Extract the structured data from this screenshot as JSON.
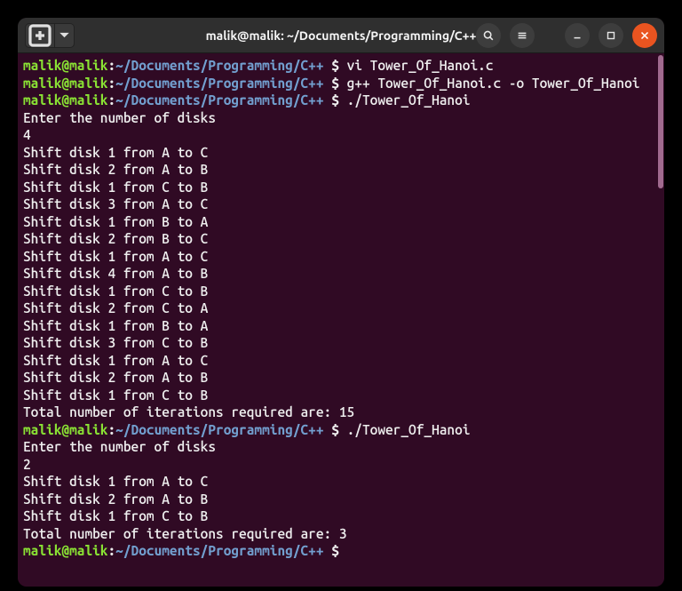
{
  "titlebar": {
    "title": "malik@malik: ~/Documents/Programming/C++",
    "newtab_icon": "new-tab-icon",
    "dropdown_icon": "chevron-down-icon",
    "search_icon": "search-icon",
    "menu_icon": "hamburger-icon",
    "min_icon": "minimize-icon",
    "max_icon": "maximize-icon",
    "close_icon": "close-icon"
  },
  "prompt": {
    "userhost": "malik@malik",
    "colon": ":",
    "path": "~/Documents/Programming/C++",
    "dollar": " $ "
  },
  "session": {
    "entries": [
      {
        "type": "prompt",
        "cmd": "vi Tower_Of_Hanoi.c"
      },
      {
        "type": "prompt",
        "cmd": "g++ Tower_Of_Hanoi.c -o Tower_Of_Hanoi"
      },
      {
        "type": "prompt",
        "cmd": "./Tower_Of_Hanoi"
      },
      {
        "type": "out",
        "text": "Enter the number of disks"
      },
      {
        "type": "out",
        "text": "4"
      },
      {
        "type": "out",
        "text": "Shift disk 1 from A to C"
      },
      {
        "type": "out",
        "text": "Shift disk 2 from A to B"
      },
      {
        "type": "out",
        "text": "Shift disk 1 from C to B"
      },
      {
        "type": "out",
        "text": "Shift disk 3 from A to C"
      },
      {
        "type": "out",
        "text": "Shift disk 1 from B to A"
      },
      {
        "type": "out",
        "text": "Shift disk 2 from B to C"
      },
      {
        "type": "out",
        "text": "Shift disk 1 from A to C"
      },
      {
        "type": "out",
        "text": "Shift disk 4 from A to B"
      },
      {
        "type": "out",
        "text": "Shift disk 1 from C to B"
      },
      {
        "type": "out",
        "text": "Shift disk 2 from C to A"
      },
      {
        "type": "out",
        "text": "Shift disk 1 from B to A"
      },
      {
        "type": "out",
        "text": "Shift disk 3 from C to B"
      },
      {
        "type": "out",
        "text": "Shift disk 1 from A to C"
      },
      {
        "type": "out",
        "text": "Shift disk 2 from A to B"
      },
      {
        "type": "out",
        "text": "Shift disk 1 from C to B"
      },
      {
        "type": "out",
        "text": "Total number of iterations required are: 15"
      },
      {
        "type": "prompt",
        "cmd": "./Tower_Of_Hanoi"
      },
      {
        "type": "out",
        "text": "Enter the number of disks"
      },
      {
        "type": "out",
        "text": "2"
      },
      {
        "type": "out",
        "text": "Shift disk 1 from A to C"
      },
      {
        "type": "out",
        "text": "Shift disk 2 from A to B"
      },
      {
        "type": "out",
        "text": "Shift disk 1 from C to B"
      },
      {
        "type": "out",
        "text": "Total number of iterations required are: 3"
      },
      {
        "type": "prompt",
        "cmd": ""
      }
    ]
  }
}
